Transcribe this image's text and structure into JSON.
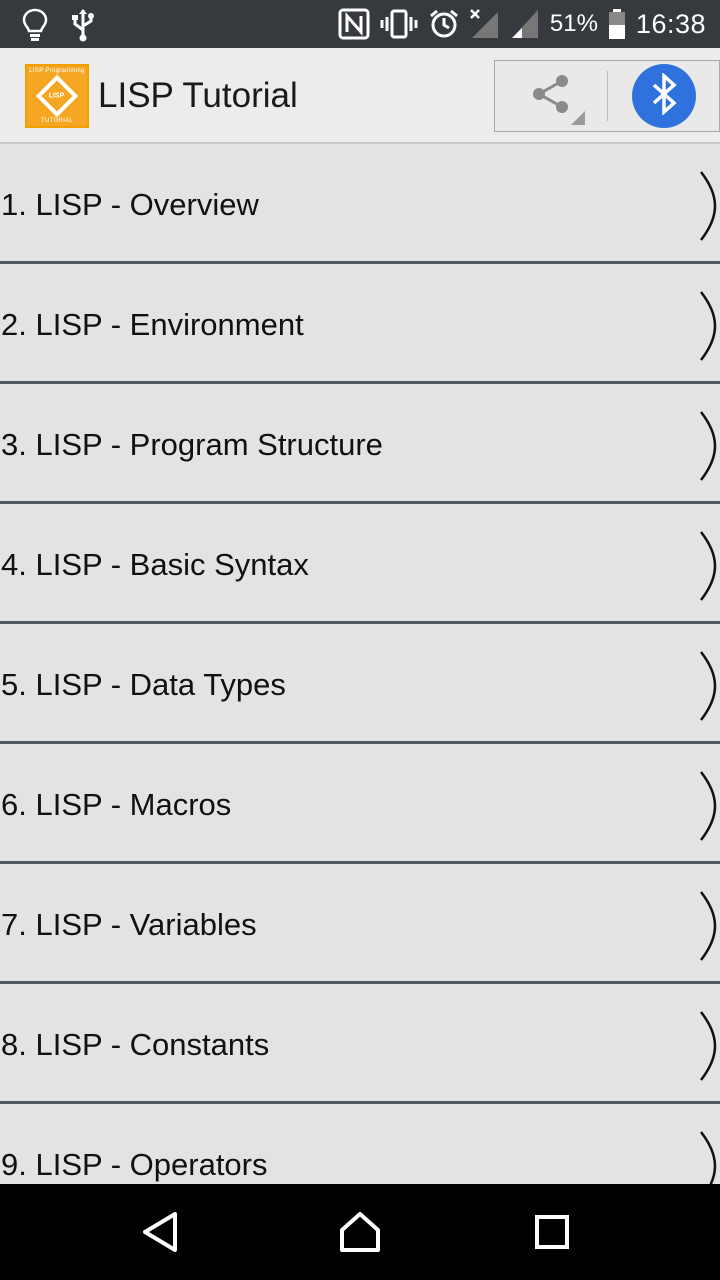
{
  "status_bar": {
    "battery_percent": "51%",
    "time": "16:38",
    "icons": [
      "lightbulb-icon",
      "usb-icon",
      "nfc-icon",
      "vibrate-icon",
      "alarm-icon",
      "signal-no-sim-icon",
      "signal-icon",
      "battery-icon"
    ]
  },
  "app_bar": {
    "logo": {
      "top_text": "LISP Programming",
      "center_text": "LISP",
      "bottom_text": "TUTORIAL"
    },
    "title": "LISP Tutorial",
    "actions": [
      "share-icon",
      "bluetooth-icon"
    ],
    "colors": {
      "bluetooth_bg": "#2f72de",
      "logo_bg": "#f5a623"
    }
  },
  "list": {
    "items": [
      {
        "label": "1. LISP - Overview"
      },
      {
        "label": "2. LISP - Environment"
      },
      {
        "label": "3. LISP - Program Structure"
      },
      {
        "label": "4. LISP - Basic Syntax"
      },
      {
        "label": "5. LISP - Data Types"
      },
      {
        "label": "6. LISP - Macros"
      },
      {
        "label": "7. LISP - Variables"
      },
      {
        "label": "8. LISP - Constants"
      },
      {
        "label": "9. LISP - Operators"
      }
    ]
  },
  "nav_bar": {
    "buttons": [
      "back-icon",
      "home-icon",
      "recents-icon"
    ]
  }
}
